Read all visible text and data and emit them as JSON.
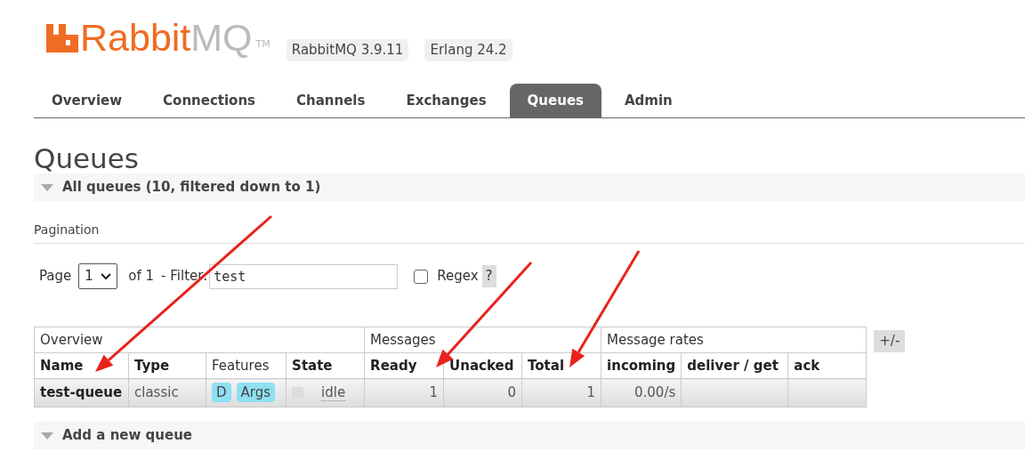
{
  "header": {
    "logo": {
      "brand": "Rabbit",
      "brand_suffix": "MQ",
      "trademark": "TM"
    },
    "versions": [
      "RabbitMQ 3.9.11",
      "Erlang 24.2"
    ]
  },
  "tabs": [
    {
      "label": "Overview",
      "selected": false
    },
    {
      "label": "Connections",
      "selected": false
    },
    {
      "label": "Channels",
      "selected": false
    },
    {
      "label": "Exchanges",
      "selected": false
    },
    {
      "label": "Queues",
      "selected": true
    },
    {
      "label": "Admin",
      "selected": false
    }
  ],
  "page_title": "Queues",
  "section": {
    "title": "All queues (10, filtered down to 1)",
    "expanded": true
  },
  "pagination": {
    "heading": "Pagination",
    "page_label": "Page",
    "page_value": "1",
    "of_label": "of 1",
    "filter_label": "- Filter:",
    "filter_value": "test",
    "regex_label": "Regex",
    "regex_checked": false,
    "help": "?"
  },
  "table": {
    "groups": [
      {
        "label": "Overview",
        "columns": [
          {
            "label": "Name",
            "sortable": true
          },
          {
            "label": "Type",
            "sortable": true
          },
          {
            "label": "Features",
            "sortable": false
          },
          {
            "label": "State",
            "sortable": true
          }
        ]
      },
      {
        "label": "Messages",
        "columns": [
          {
            "label": "Ready",
            "sortable": true
          },
          {
            "label": "Unacked",
            "sortable": true
          },
          {
            "label": "Total",
            "sortable": true
          }
        ]
      },
      {
        "label": "Message rates",
        "columns": [
          {
            "label": "incoming",
            "sortable": true
          },
          {
            "label": "deliver / get",
            "sortable": true
          },
          {
            "label": "ack",
            "sortable": true
          }
        ]
      }
    ],
    "rows": [
      {
        "name": "test-queue",
        "type": "classic",
        "features": [
          "D",
          "Args"
        ],
        "state": "idle",
        "ready": "1",
        "unacked": "0",
        "total": "1",
        "incoming": "0.00/s"
      }
    ],
    "toggle": "+/-"
  },
  "add_section": {
    "title": "Add a new queue",
    "expanded": true
  }
}
